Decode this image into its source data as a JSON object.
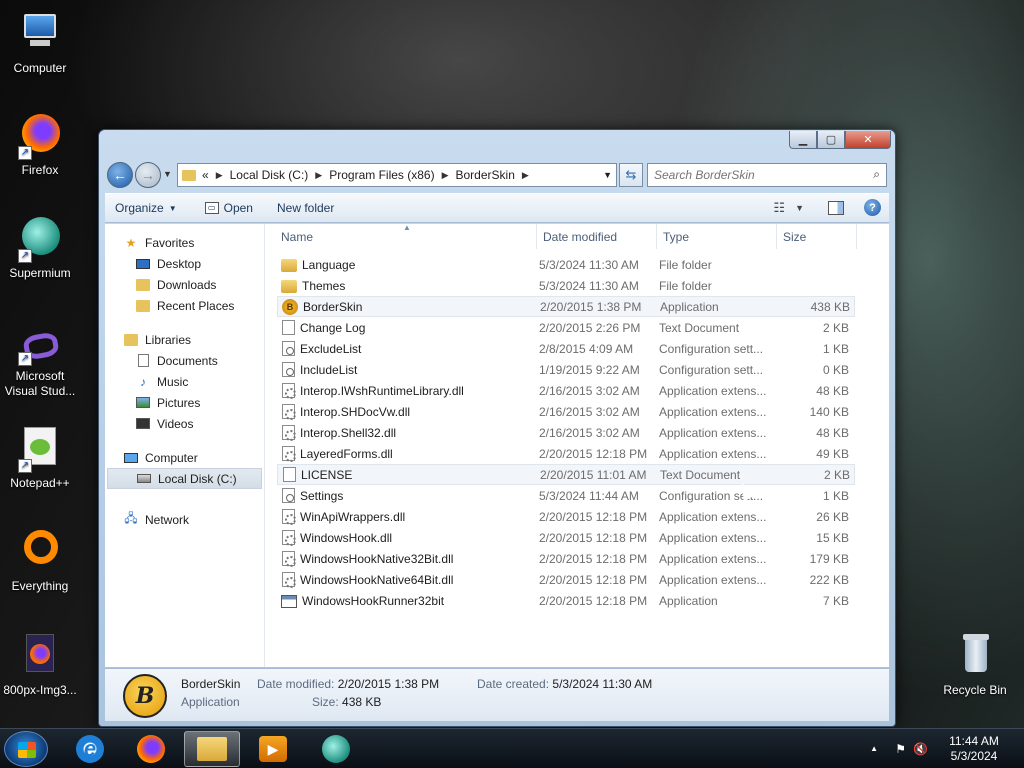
{
  "desktop": {
    "icons": [
      {
        "label": "Computer",
        "icon": "computer-icon"
      },
      {
        "label": "Firefox",
        "icon": "firefox-icon"
      },
      {
        "label": "Supermium",
        "icon": "supermium-icon"
      },
      {
        "label": "Microsoft Visual Stud...",
        "icon": "visual-studio-icon"
      },
      {
        "label": "Notepad++",
        "icon": "notepadpp-icon"
      },
      {
        "label": "Everything",
        "icon": "everything-icon"
      },
      {
        "label": "800px-Img3...",
        "icon": "image-file-icon"
      },
      {
        "label": "Recycle Bin",
        "icon": "recycle-bin-icon"
      }
    ]
  },
  "window": {
    "breadcrumb": {
      "overflow": "«",
      "items": [
        "Local Disk (C:)",
        "Program Files (x86)",
        "BorderSkin"
      ]
    },
    "search_placeholder": "Search BorderSkin",
    "toolbar": {
      "organize": "Organize",
      "open": "Open",
      "new_folder": "New folder"
    },
    "nav_pane": {
      "favorites": {
        "label": "Favorites",
        "items": [
          "Desktop",
          "Downloads",
          "Recent Places"
        ]
      },
      "libraries": {
        "label": "Libraries",
        "items": [
          "Documents",
          "Music",
          "Pictures",
          "Videos"
        ]
      },
      "computer": {
        "label": "Computer",
        "items": [
          "Local Disk (C:)"
        ]
      },
      "network": {
        "label": "Network"
      }
    },
    "columns": {
      "name": "Name",
      "date": "Date modified",
      "type": "Type",
      "size": "Size"
    },
    "files": [
      {
        "name": "Language",
        "date": "5/3/2024 11:30 AM",
        "type": "File folder",
        "size": "",
        "icon": "folder"
      },
      {
        "name": "Themes",
        "date": "5/3/2024 11:30 AM",
        "type": "File folder",
        "size": "",
        "icon": "folder"
      },
      {
        "name": "BorderSkin",
        "date": "2/20/2015 1:38 PM",
        "type": "Application",
        "size": "438 KB",
        "icon": "app-b"
      },
      {
        "name": "Change Log",
        "date": "2/20/2015 2:26 PM",
        "type": "Text Document",
        "size": "2 KB",
        "icon": "doc"
      },
      {
        "name": "ExcludeList",
        "date": "2/8/2015 4:09 AM",
        "type": "Configuration sett...",
        "size": "1 KB",
        "icon": "cfg"
      },
      {
        "name": "IncludeList",
        "date": "1/19/2015 9:22 AM",
        "type": "Configuration sett...",
        "size": "0 KB",
        "icon": "cfg"
      },
      {
        "name": "Interop.IWshRuntimeLibrary.dll",
        "date": "2/16/2015 3:02 AM",
        "type": "Application extens...",
        "size": "48 KB",
        "icon": "dll"
      },
      {
        "name": "Interop.SHDocVw.dll",
        "date": "2/16/2015 3:02 AM",
        "type": "Application extens...",
        "size": "140 KB",
        "icon": "dll"
      },
      {
        "name": "Interop.Shell32.dll",
        "date": "2/16/2015 3:02 AM",
        "type": "Application extens...",
        "size": "48 KB",
        "icon": "dll"
      },
      {
        "name": "LayeredForms.dll",
        "date": "2/20/2015 12:18 PM",
        "type": "Application extens...",
        "size": "49 KB",
        "icon": "dll"
      },
      {
        "name": "LICENSE",
        "date": "2/20/2015 11:01 AM",
        "type": "Text Document",
        "size": "2 KB",
        "icon": "doc"
      },
      {
        "name": "Settings",
        "date": "5/3/2024 11:44 AM",
        "type": "Configuration sett...",
        "size": "1 KB",
        "icon": "cfg"
      },
      {
        "name": "WinApiWrappers.dll",
        "date": "2/20/2015 12:18 PM",
        "type": "Application extens...",
        "size": "26 KB",
        "icon": "dll"
      },
      {
        "name": "WindowsHook.dll",
        "date": "2/20/2015 12:18 PM",
        "type": "Application extens...",
        "size": "15 KB",
        "icon": "dll"
      },
      {
        "name": "WindowsHookNative32Bit.dll",
        "date": "2/20/2015 12:18 PM",
        "type": "Application extens...",
        "size": "179 KB",
        "icon": "dll"
      },
      {
        "name": "WindowsHookNative64Bit.dll",
        "date": "2/20/2015 12:18 PM",
        "type": "Application extens...",
        "size": "222 KB",
        "icon": "dll"
      },
      {
        "name": "WindowsHookRunner32bit",
        "date": "2/20/2015 12:18 PM",
        "type": "Application",
        "size": "7 KB",
        "icon": "exe"
      }
    ],
    "details": {
      "name": "BorderSkin",
      "type": "Application",
      "date_modified_label": "Date modified:",
      "date_modified": "2/20/2015 1:38 PM",
      "date_created_label": "Date created:",
      "date_created": "5/3/2024 11:30 AM",
      "size_label": "Size:",
      "size": "438 KB",
      "icon_letter": "B"
    }
  },
  "taskbar": {
    "apps": [
      "internet-explorer-icon",
      "firefox-icon",
      "explorer-icon",
      "media-player-icon",
      "supermium-icon"
    ],
    "clock_time": "11:44 AM",
    "clock_date": "5/3/2024"
  }
}
